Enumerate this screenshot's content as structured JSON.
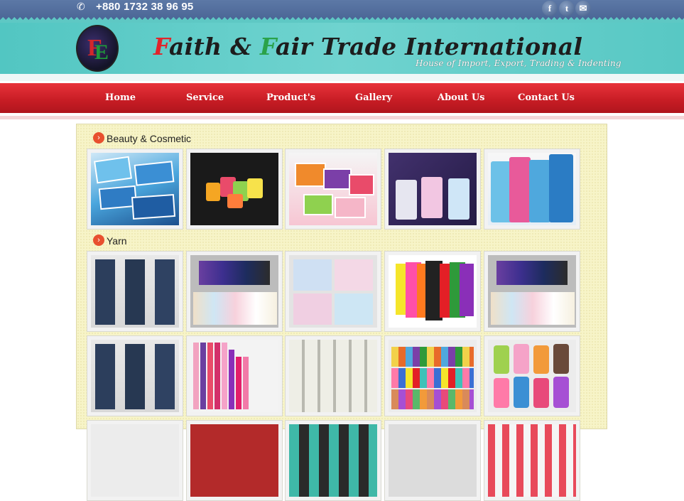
{
  "topbar": {
    "phone": "+880 1732 38 96 95",
    "social": [
      {
        "name": "facebook-icon",
        "glyph": "f"
      },
      {
        "name": "twitter-icon",
        "glyph": "t"
      },
      {
        "name": "email-icon",
        "glyph": "✉"
      }
    ]
  },
  "header": {
    "brand_parts": [
      "F",
      "aith & ",
      "F",
      "air Trade International"
    ],
    "tagline": "House of Import, Export, Trading & Indenting",
    "logo_letters": [
      "F",
      "E"
    ]
  },
  "nav": {
    "items": [
      "Home",
      "Service",
      "Product's",
      "Gallery",
      "About Us",
      "Contact Us"
    ]
  },
  "sections": [
    {
      "title": "Beauty & Cosmetic",
      "images": [
        "Medicare soap packs",
        "Candy assortment",
        "Candy packs",
        "Dash detergent packs",
        "Daia detergent packs"
      ]
    },
    {
      "title": "Yarn",
      "images": [
        "Jeans",
        "Polo shirts",
        "Dress shirts",
        "Colored t-shirts",
        "Polo shirts stack",
        "Jeans",
        "Zippers",
        "White yarn cones",
        "Colored yarn cones",
        "Yarn cones"
      ]
    }
  ],
  "colors": {
    "topbar": "#5c78a6",
    "header": "#5ec8c4",
    "nav": "#d0242c",
    "panel": "#f7f4c8",
    "accent": "#e8502f"
  }
}
